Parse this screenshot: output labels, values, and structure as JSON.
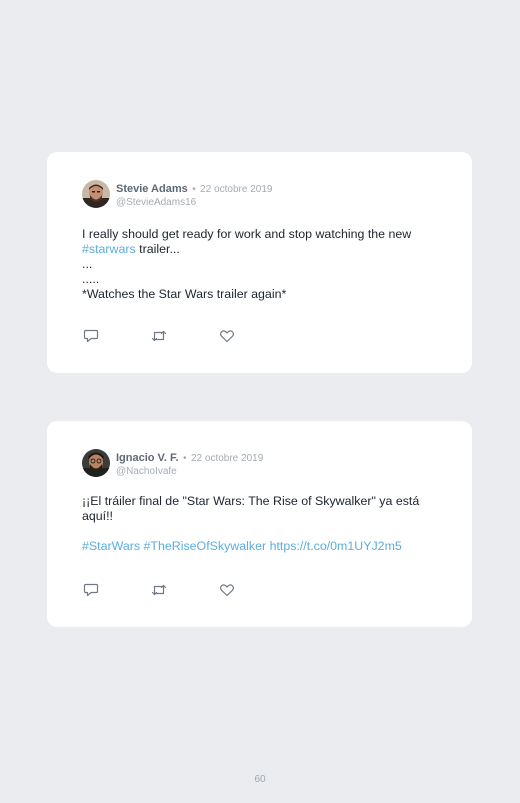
{
  "tweets": [
    {
      "author_name": "Stevie Adams",
      "separator": "•",
      "date": "22 octobre 2019",
      "handle": "@StevieAdams16",
      "text_before_tag": "I really should get ready for work and stop watching the new ",
      "hashtag": "#starwars",
      "text_after_tag": " trailer...",
      "line_2": "...",
      "line_3": ".....",
      "line_4": "*Watches the Star Wars trailer again*"
    },
    {
      "author_name": "Ignacio V. F.",
      "separator": "•",
      "date": "22 octobre 2019",
      "handle": "@NachoIvafe",
      "line_1": "¡¡El tráiler final de \"Star Wars: The Rise of Skywalker\" ya está aquí!!",
      "hashtag_1": "#StarWars",
      "hashtag_2": "#TheRiseOfSkywalker",
      "link": "https://t.co/0m1UYJ2m5"
    }
  ],
  "page_number": "60",
  "colors": {
    "background": "#ebecf0",
    "card": "#ffffff",
    "link": "#5aaedd",
    "muted": "#a3acb5",
    "name": "#5d6a77",
    "text": "#1c2530"
  },
  "icons": [
    "reply-icon",
    "retweet-icon",
    "like-icon"
  ]
}
